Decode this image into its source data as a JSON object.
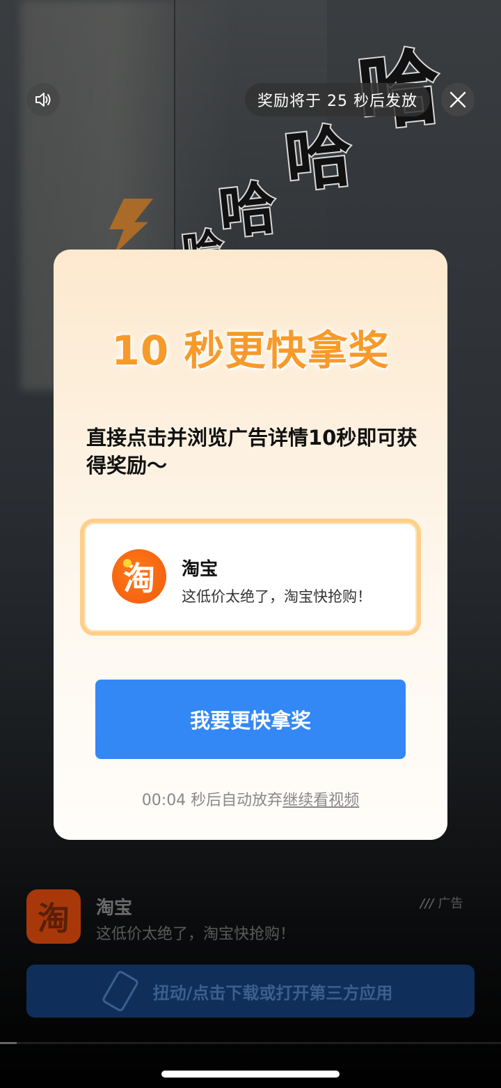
{
  "top_bar": {
    "sound_icon": "speaker-icon",
    "reward_countdown": "奖励将于 25 秒后发放",
    "close_icon": "close-icon"
  },
  "background": {
    "ha_text": "哈"
  },
  "modal": {
    "headline": "10 秒更快拿奖",
    "description": "直接点击并浏览广告详情10秒即可获得奖励～",
    "app": {
      "logo_char": "淘",
      "name": "淘宝",
      "slogan": "这低价太绝了，淘宝快抢购！"
    },
    "cta_label": "我要更快拿奖",
    "timer_text": "00:04 秒后自动放弃",
    "continue_label": "继续看视频"
  },
  "ad_bar": {
    "logo_char": "淘",
    "title": "淘宝",
    "description": "这低价太绝了，淘宝快抢购！",
    "ad_tag": "广告",
    "action_label": "扭动/点击下载或打开第三方应用"
  },
  "colors": {
    "accent_orange": "#f79a2a",
    "cta_blue": "#3388f6",
    "taobao_orange": "#f25a0b"
  }
}
